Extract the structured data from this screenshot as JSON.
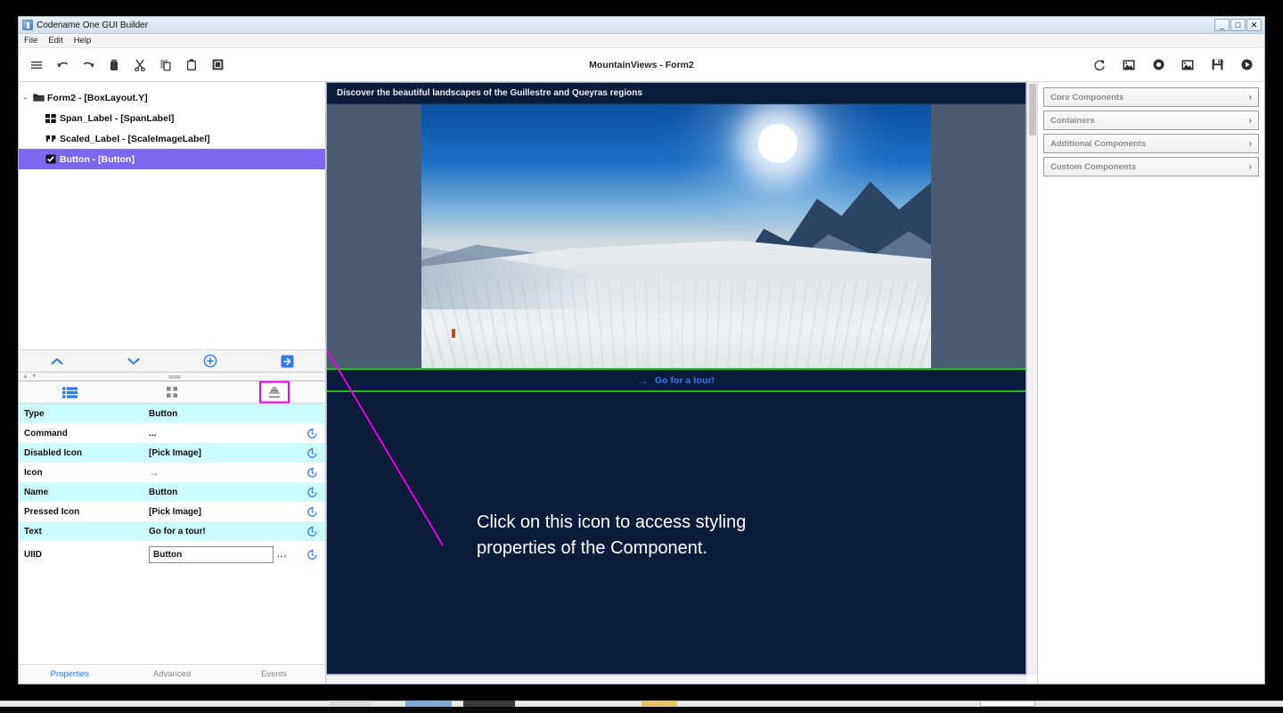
{
  "window": {
    "title": "Codename One GUI Builder",
    "app_icon": "app-icon",
    "controls": {
      "minimize": "_",
      "maximize": "□",
      "close": "✕"
    }
  },
  "menubar": {
    "items": [
      "File",
      "Edit",
      "Help"
    ]
  },
  "toolbar": {
    "title": "MountainViews - Form2",
    "left_icons": [
      {
        "name": "hamburger-menu-icon",
        "glyph": "menu"
      },
      {
        "name": "undo-icon",
        "glyph": "undo"
      },
      {
        "name": "redo-icon",
        "glyph": "redo"
      },
      {
        "name": "delete-icon",
        "glyph": "trash"
      },
      {
        "name": "cut-icon",
        "glyph": "scissors"
      },
      {
        "name": "copy-icon",
        "glyph": "copy"
      },
      {
        "name": "paste-icon",
        "glyph": "clipboard"
      },
      {
        "name": "stop-icon",
        "glyph": "square"
      }
    ],
    "right_icons": [
      {
        "name": "refresh-icon",
        "glyph": "refresh"
      },
      {
        "name": "image-icon",
        "glyph": "image"
      },
      {
        "name": "record-icon",
        "glyph": "circle"
      },
      {
        "name": "image-2-icon",
        "glyph": "image"
      },
      {
        "name": "save-icon",
        "glyph": "floppy"
      },
      {
        "name": "run-icon",
        "glyph": "play-circle"
      }
    ]
  },
  "tree": {
    "nodes": [
      {
        "label": "Form2 - [BoxLayout.Y]",
        "icon": "folder-icon",
        "indent": 0,
        "selected": false,
        "toggle": "-"
      },
      {
        "label": "Span_Label - [SpanLabel]",
        "icon": "span-label-icon",
        "indent": 1,
        "selected": false,
        "toggle": ""
      },
      {
        "label": "Scaled_Label - [ScaleImageLabel]",
        "icon": "scale-image-label-icon",
        "indent": 1,
        "selected": false,
        "toggle": ""
      },
      {
        "label": "Button - [Button]",
        "icon": "button-icon",
        "indent": 1,
        "selected": true,
        "toggle": ""
      }
    ],
    "nav_buttons": [
      {
        "name": "move-up-button",
        "glyph": "chevron-up"
      },
      {
        "name": "move-down-button",
        "glyph": "chevron-down"
      },
      {
        "name": "add-component-button",
        "glyph": "plus-circle"
      },
      {
        "name": "insert-container-button",
        "glyph": "square-arrow"
      }
    ]
  },
  "property_tabs": {
    "icons": [
      {
        "name": "list-view-tab",
        "glyph": "list",
        "active": true
      },
      {
        "name": "grid-view-tab",
        "glyph": "grid",
        "active": false
      },
      {
        "name": "styling-properties-tab",
        "glyph": "paint-style",
        "active": false,
        "highlighted": true
      }
    ]
  },
  "properties": {
    "rows": [
      {
        "key": "Type",
        "value": "Button",
        "has_revert": false,
        "editable": false
      },
      {
        "key": "Command",
        "value": "...",
        "has_revert": true,
        "editable": false
      },
      {
        "key": "Disabled Icon",
        "value": "[Pick Image]",
        "has_revert": true,
        "editable": false
      },
      {
        "key": "Icon",
        "value": "→",
        "has_revert": true,
        "editable": false
      },
      {
        "key": "Name",
        "value": "Button",
        "has_revert": true,
        "editable": false
      },
      {
        "key": "Pressed Icon",
        "value": "[Pick Image]",
        "has_revert": true,
        "editable": false
      },
      {
        "key": "Text",
        "value": "Go for a tour!",
        "has_revert": true,
        "editable": false
      },
      {
        "key": "UIID",
        "value": "Button",
        "has_revert": true,
        "editable": true,
        "ellipsis": "..."
      }
    ],
    "bottom_tabs": [
      {
        "label": "Properties",
        "active": true
      },
      {
        "label": "Advanced",
        "active": false
      },
      {
        "label": "Events",
        "active": false
      }
    ]
  },
  "canvas": {
    "header_text": "Discover the beautiful landscapes of the Guillestre and Queyras regions",
    "button": {
      "icon": "arrow-right-icon",
      "icon_glyph": "→",
      "label": "Go for a tour!"
    },
    "annotation": {
      "line1": "Click on this icon to access styling",
      "line2": "properties of the Component."
    }
  },
  "palette": {
    "rows": [
      {
        "label": "Core Components",
        "chevron": "›"
      },
      {
        "label": "Containers",
        "chevron": "›"
      },
      {
        "label": "Additional Components",
        "chevron": "›"
      },
      {
        "label": "Custom Components",
        "chevron": "›"
      }
    ]
  },
  "colors": {
    "selection": "#7b68ee",
    "property_alt_row": "#ccfcfc",
    "accent_blue": "#2e7eea",
    "annotation_magenta": "#ee00ee",
    "canvas_bg": "#0b1c3a",
    "button_border_green": "#16c216"
  }
}
